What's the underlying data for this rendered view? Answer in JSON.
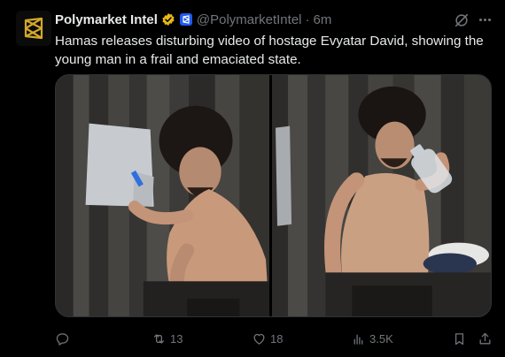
{
  "author": {
    "name": "Polymarket Intel",
    "handle": "@PolymarketIntel",
    "separator": "·",
    "time": "6m",
    "verified_color": "#e8b818",
    "affiliate_color": "#1d5af0",
    "avatar_icon": "polymarket-logo-icon"
  },
  "tweet": {
    "text": "Hamas releases disturbing video of hostage Evyatar David, showing the young man in a frail and emaciated state."
  },
  "media": {
    "images": [
      {
        "name": "hostage-writing-on-wall-photo"
      },
      {
        "name": "hostage-drinking-water-photo"
      }
    ]
  },
  "actions": {
    "reply": {
      "icon": "reply-icon",
      "count": ""
    },
    "repost": {
      "icon": "repost-icon",
      "count": "13"
    },
    "like": {
      "icon": "heart-icon",
      "count": "18"
    },
    "views": {
      "icon": "views-icon",
      "count": "3.5K"
    },
    "bookmark": {
      "icon": "bookmark-icon"
    },
    "share": {
      "icon": "share-icon"
    }
  },
  "colors": {
    "background": "#000000",
    "text": "#e7e9ea",
    "secondary": "#71767b",
    "border": "#2f3336"
  }
}
